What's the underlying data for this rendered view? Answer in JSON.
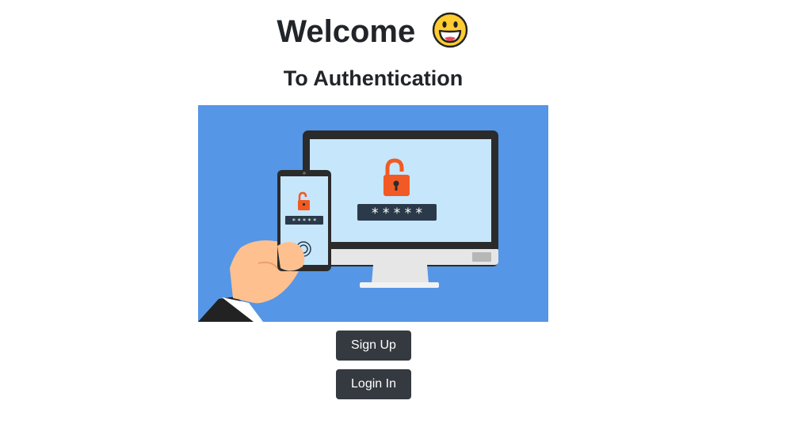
{
  "header": {
    "title": "Welcome",
    "emoji": "grinning-face-emoji",
    "subtitle": "To Authentication"
  },
  "hero": {
    "illustration": "phone-and-monitor-unlock-illustration",
    "phone_password": "* * * * *",
    "monitor_password": "* * * * *",
    "colors": {
      "background": "#5596e6",
      "screen": "#c6e6fb",
      "lock": "#f15a24",
      "bezel": "#2b2b2b"
    }
  },
  "actions": {
    "signup_label": "Sign Up",
    "login_label": "Login In",
    "button_color": "#343a40"
  }
}
